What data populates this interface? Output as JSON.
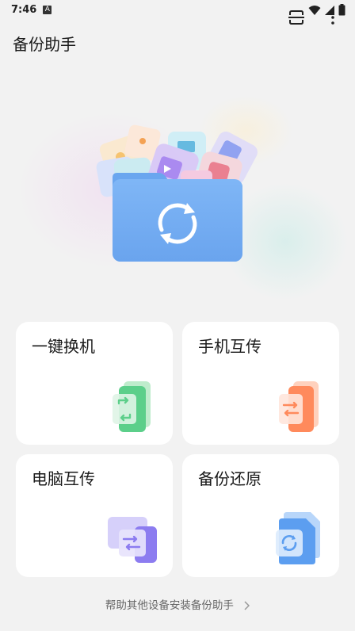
{
  "status_bar": {
    "time": "7:46",
    "notification_letter": "A",
    "icons": [
      "wifi-icon",
      "cellular-signal-icon",
      "battery-icon"
    ]
  },
  "app_bar": {
    "title": "备份助手",
    "actions": [
      "scan-icon",
      "more-vertical-icon"
    ]
  },
  "hero": {
    "illustration": "folder-sync-illustration"
  },
  "cards": [
    {
      "label": "一键换机",
      "icon": "phone-switch-icon",
      "color": "#5ccf8a"
    },
    {
      "label": "手机互传",
      "icon": "phone-transfer-icon",
      "color": "#ff8a5c"
    },
    {
      "label": "电脑互传",
      "icon": "computer-transfer-icon",
      "color": "#8c7cf0"
    },
    {
      "label": "备份还原",
      "icon": "backup-restore-icon",
      "color": "#5c9ef0"
    }
  ],
  "footer": {
    "link_text": "帮助其他设备安装备份助手"
  },
  "colors": {
    "background": "#f2f2f2",
    "card": "#ffffff",
    "folder_blue": "#78b2f5"
  }
}
